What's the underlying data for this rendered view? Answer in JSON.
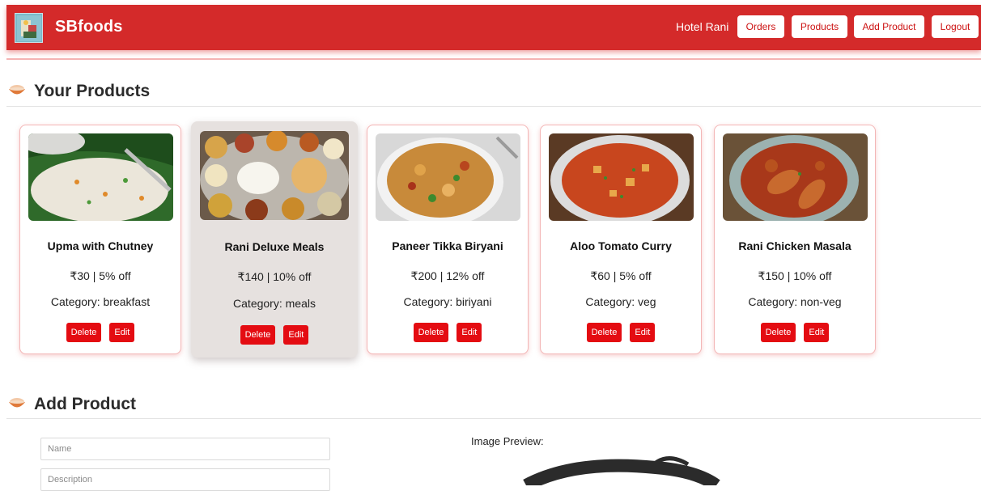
{
  "header": {
    "brand": "SBfoods",
    "user": "Hotel Rani",
    "nav": {
      "orders": "Orders",
      "products": "Products",
      "add_product": "Add Product",
      "logout": "Logout"
    }
  },
  "your_products": {
    "title": "Your Products",
    "items": [
      {
        "name": "Upma with Chutney",
        "price": "₹30 | 5% off",
        "category": "Category: breakfast",
        "delete": "Delete",
        "edit": "Edit"
      },
      {
        "name": "Rani Deluxe Meals",
        "price": "₹140 | 10% off",
        "category": "Category: meals",
        "delete": "Delete",
        "edit": "Edit"
      },
      {
        "name": "Paneer Tikka Biryani",
        "price": "₹200 | 12% off",
        "category": "Category: biriyani",
        "delete": "Delete",
        "edit": "Edit"
      },
      {
        "name": "Aloo Tomato Curry",
        "price": "₹60 | 5% off",
        "category": "Category: veg",
        "delete": "Delete",
        "edit": "Edit"
      },
      {
        "name": "Rani Chicken Masala",
        "price": "₹150 | 10% off",
        "category": "Category: non-veg",
        "delete": "Delete",
        "edit": "Edit"
      }
    ]
  },
  "add_product": {
    "title": "Add Product",
    "name_placeholder": "Name",
    "description_placeholder": "Description",
    "image_preview_label": "Image Preview:"
  },
  "colors": {
    "navbar": "#d42a2a",
    "button_red": "#e40c12",
    "highlight_card": "#e6e1df"
  }
}
